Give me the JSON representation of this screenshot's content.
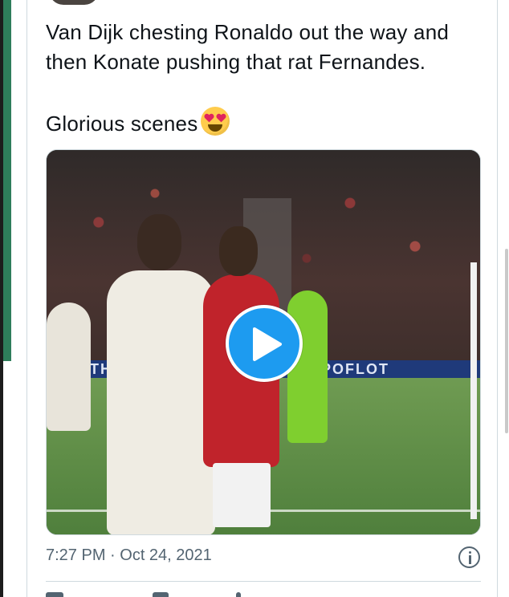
{
  "tweet": {
    "text_line1": "Van Dijk chesting Ronaldo out the way and",
    "text_line2": "then Konate pushing that rat Fernandes.",
    "text_line3": "Glorious scenes",
    "emoji_icon": "heart-eyes-emoji-icon",
    "timestamp": "7:27 PM · Oct 24, 2021"
  },
  "media": {
    "type": "video",
    "ad_text_left": "ETH",
    "ad_text_right": "POFLOT",
    "play_icon": "play-icon"
  },
  "colors": {
    "accent": "#1d9bf0",
    "text": "#0f1419",
    "muted": "#536471",
    "border": "#cfd9de",
    "emoji": "#ffcc4d",
    "edge_green": "#2e7d5b"
  }
}
